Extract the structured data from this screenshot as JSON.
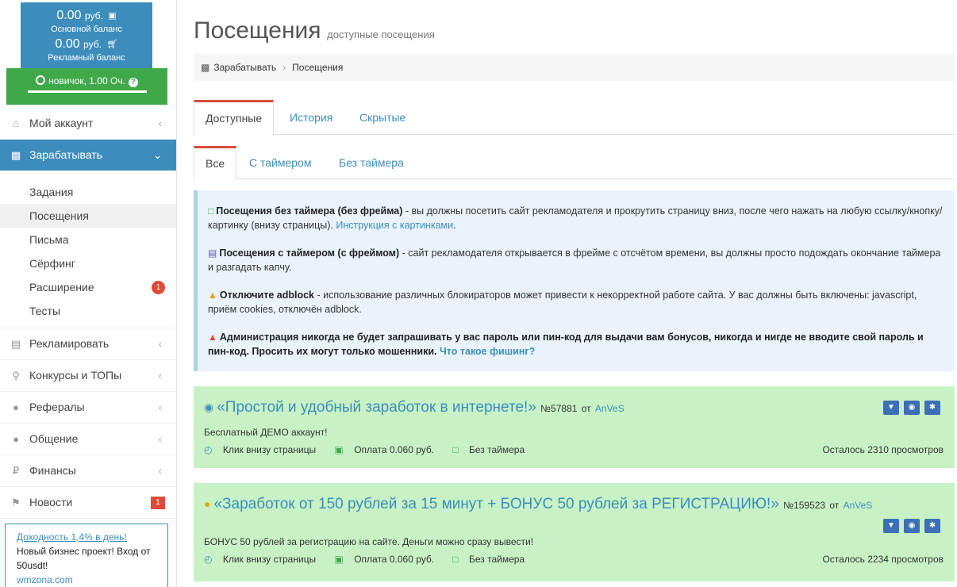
{
  "balance": {
    "main_amount": "0.00",
    "currency": "руб.",
    "main_label": "Основной баланс",
    "ad_amount": "0.00",
    "ad_label": "Рекламный баланс",
    "rank": "новичок, 1.00 Оч.",
    "main_icon": "money-icon",
    "ad_icon": "cart-icon"
  },
  "sidebar": {
    "menu": [
      {
        "label": "Мой аккаунт",
        "icon": "home-icon"
      },
      {
        "label": "Зарабатывать",
        "icon": "briefcase-icon"
      },
      {
        "label": "Рекламировать",
        "icon": "bar-chart-icon"
      },
      {
        "label": "Конкурсы и ТОПы",
        "icon": "trophy-icon"
      },
      {
        "label": "Рефералы",
        "icon": "users-icon"
      },
      {
        "label": "Общение",
        "icon": "comments-icon"
      },
      {
        "label": "Финансы",
        "icon": "ruble-icon"
      },
      {
        "label": "Новости",
        "icon": "bullhorn-icon",
        "badge": "1"
      }
    ],
    "submenu": [
      {
        "label": "Задания"
      },
      {
        "label": "Посещения"
      },
      {
        "label": "Письма"
      },
      {
        "label": "Сёрфинг"
      },
      {
        "label": "Расширение",
        "badge": "1"
      },
      {
        "label": "Тесты"
      }
    ],
    "ad": {
      "link": "Доходность 1,4% в день!",
      "text": "Новый бизнес проект! Вход от 50usdt!",
      "site": "wmzona.com"
    }
  },
  "page": {
    "title": "Посещения",
    "subtitle": "доступные посещения",
    "breadcrumb": [
      "Зарабатывать",
      "Посещения"
    ]
  },
  "tabs_primary": [
    "Доступные",
    "История",
    "Скрытые"
  ],
  "tabs_secondary": [
    "Все",
    "С таймером",
    "Без таймера"
  ],
  "info": {
    "p1_bold": "Посещения без таймера (без фрейма)",
    "p1_text": " - вы должны посетить сайт рекламодателя и прокрутить страницу вниз, после чего нажать на любую ссылку/кнопку/картинку (внизу страницы). ",
    "p1_link": "Инструкция с картинками",
    "p2_bold": "Посещения с таймером (с фреймом)",
    "p2_text": " - сайт рекламодателя открывается в фрейме с отсчётом времени, вы должны просто подождать окончание таймера и разгадать капчу.",
    "p3_bold": "Отключите adblock",
    "p3_text": " - использование различных блокираторов может привести к некорректной работе сайта. У вас должны быть включены: javascript, приём cookies, отключён adblock.",
    "p4_bold": "Администрация никогда не будет запрашивать у вас пароль или пин-код для выдачи вам бонусов, никогда и нигде не вводите свой пароль и пин-код. Просить их могут только мошенники.",
    "p4_link": "Что такое фишинг?"
  },
  "tasks": [
    {
      "title": "«Простой и удобный заработок в интернете!»",
      "number": "№57881",
      "by": "от",
      "author": "AnVeS",
      "description": "Бесплатный ДЕМО аккаунт!",
      "click": "Клик внизу страницы",
      "pay": "Оплата 0.060 руб.",
      "timer": "Без таймера",
      "remaining": "Осталось 2310 просмотров"
    },
    {
      "title": "«Заработок от 150 рублей за 15 минут + БОНУС 50 рублей за РЕГИСТРАЦИЮ!»",
      "number": "№159523",
      "by": "от",
      "author": "AnVeS",
      "description": "БОНУС 50 рублей за регистрацию на сайте. Деньги можно сразу вывести!",
      "click": "Клик внизу страницы",
      "pay": "Оплата 0.060 руб.",
      "timer": "Без таймера",
      "remaining": "Осталось 2234 просмотров"
    }
  ],
  "colors": {
    "accent": "#3c8dbc",
    "rank_green": "#3fa94a",
    "badge_red": "#dd4b39",
    "task_bg": "#c8f2c5",
    "info_bg": "#eaf3fb"
  }
}
